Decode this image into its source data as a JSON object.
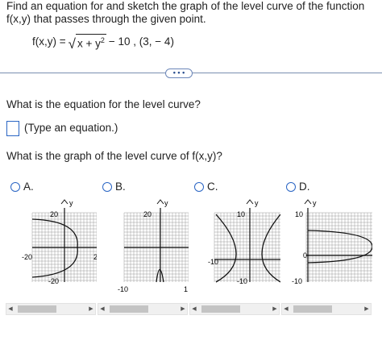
{
  "question": {
    "intro": "Find an equation for and sketch the graph of the level curve of the function f(x,y) that passes through the given point.",
    "formula_lhs": "f(x,y) = ",
    "formula_radicand_a": "x + y",
    "formula_exp": "2",
    "formula_tail": " − 10 , (3, − 4)"
  },
  "more_button": "• • •",
  "part1": {
    "prompt": "What is the equation for the level curve?",
    "hint": "(Type an equation.)"
  },
  "part2": {
    "prompt": "What is the graph of the level curve of f(x,y)?"
  },
  "options": [
    {
      "letter": "A.",
      "ylabel": "y",
      "ticks": [
        "20",
        "-20",
        "2",
        "-20"
      ]
    },
    {
      "letter": "B.",
      "ylabel": "y",
      "ticks": [
        "20",
        "-10",
        "1"
      ]
    },
    {
      "letter": "C.",
      "ylabel": "y",
      "ticks": [
        "10",
        "-10",
        "-10"
      ]
    },
    {
      "letter": "D.",
      "ylabel": "y",
      "ticks": [
        "10",
        "0",
        "-10"
      ]
    }
  ],
  "colors": {
    "accent": "#2a65c4",
    "grid": "#9a9a9a",
    "curve": "#111111"
  }
}
